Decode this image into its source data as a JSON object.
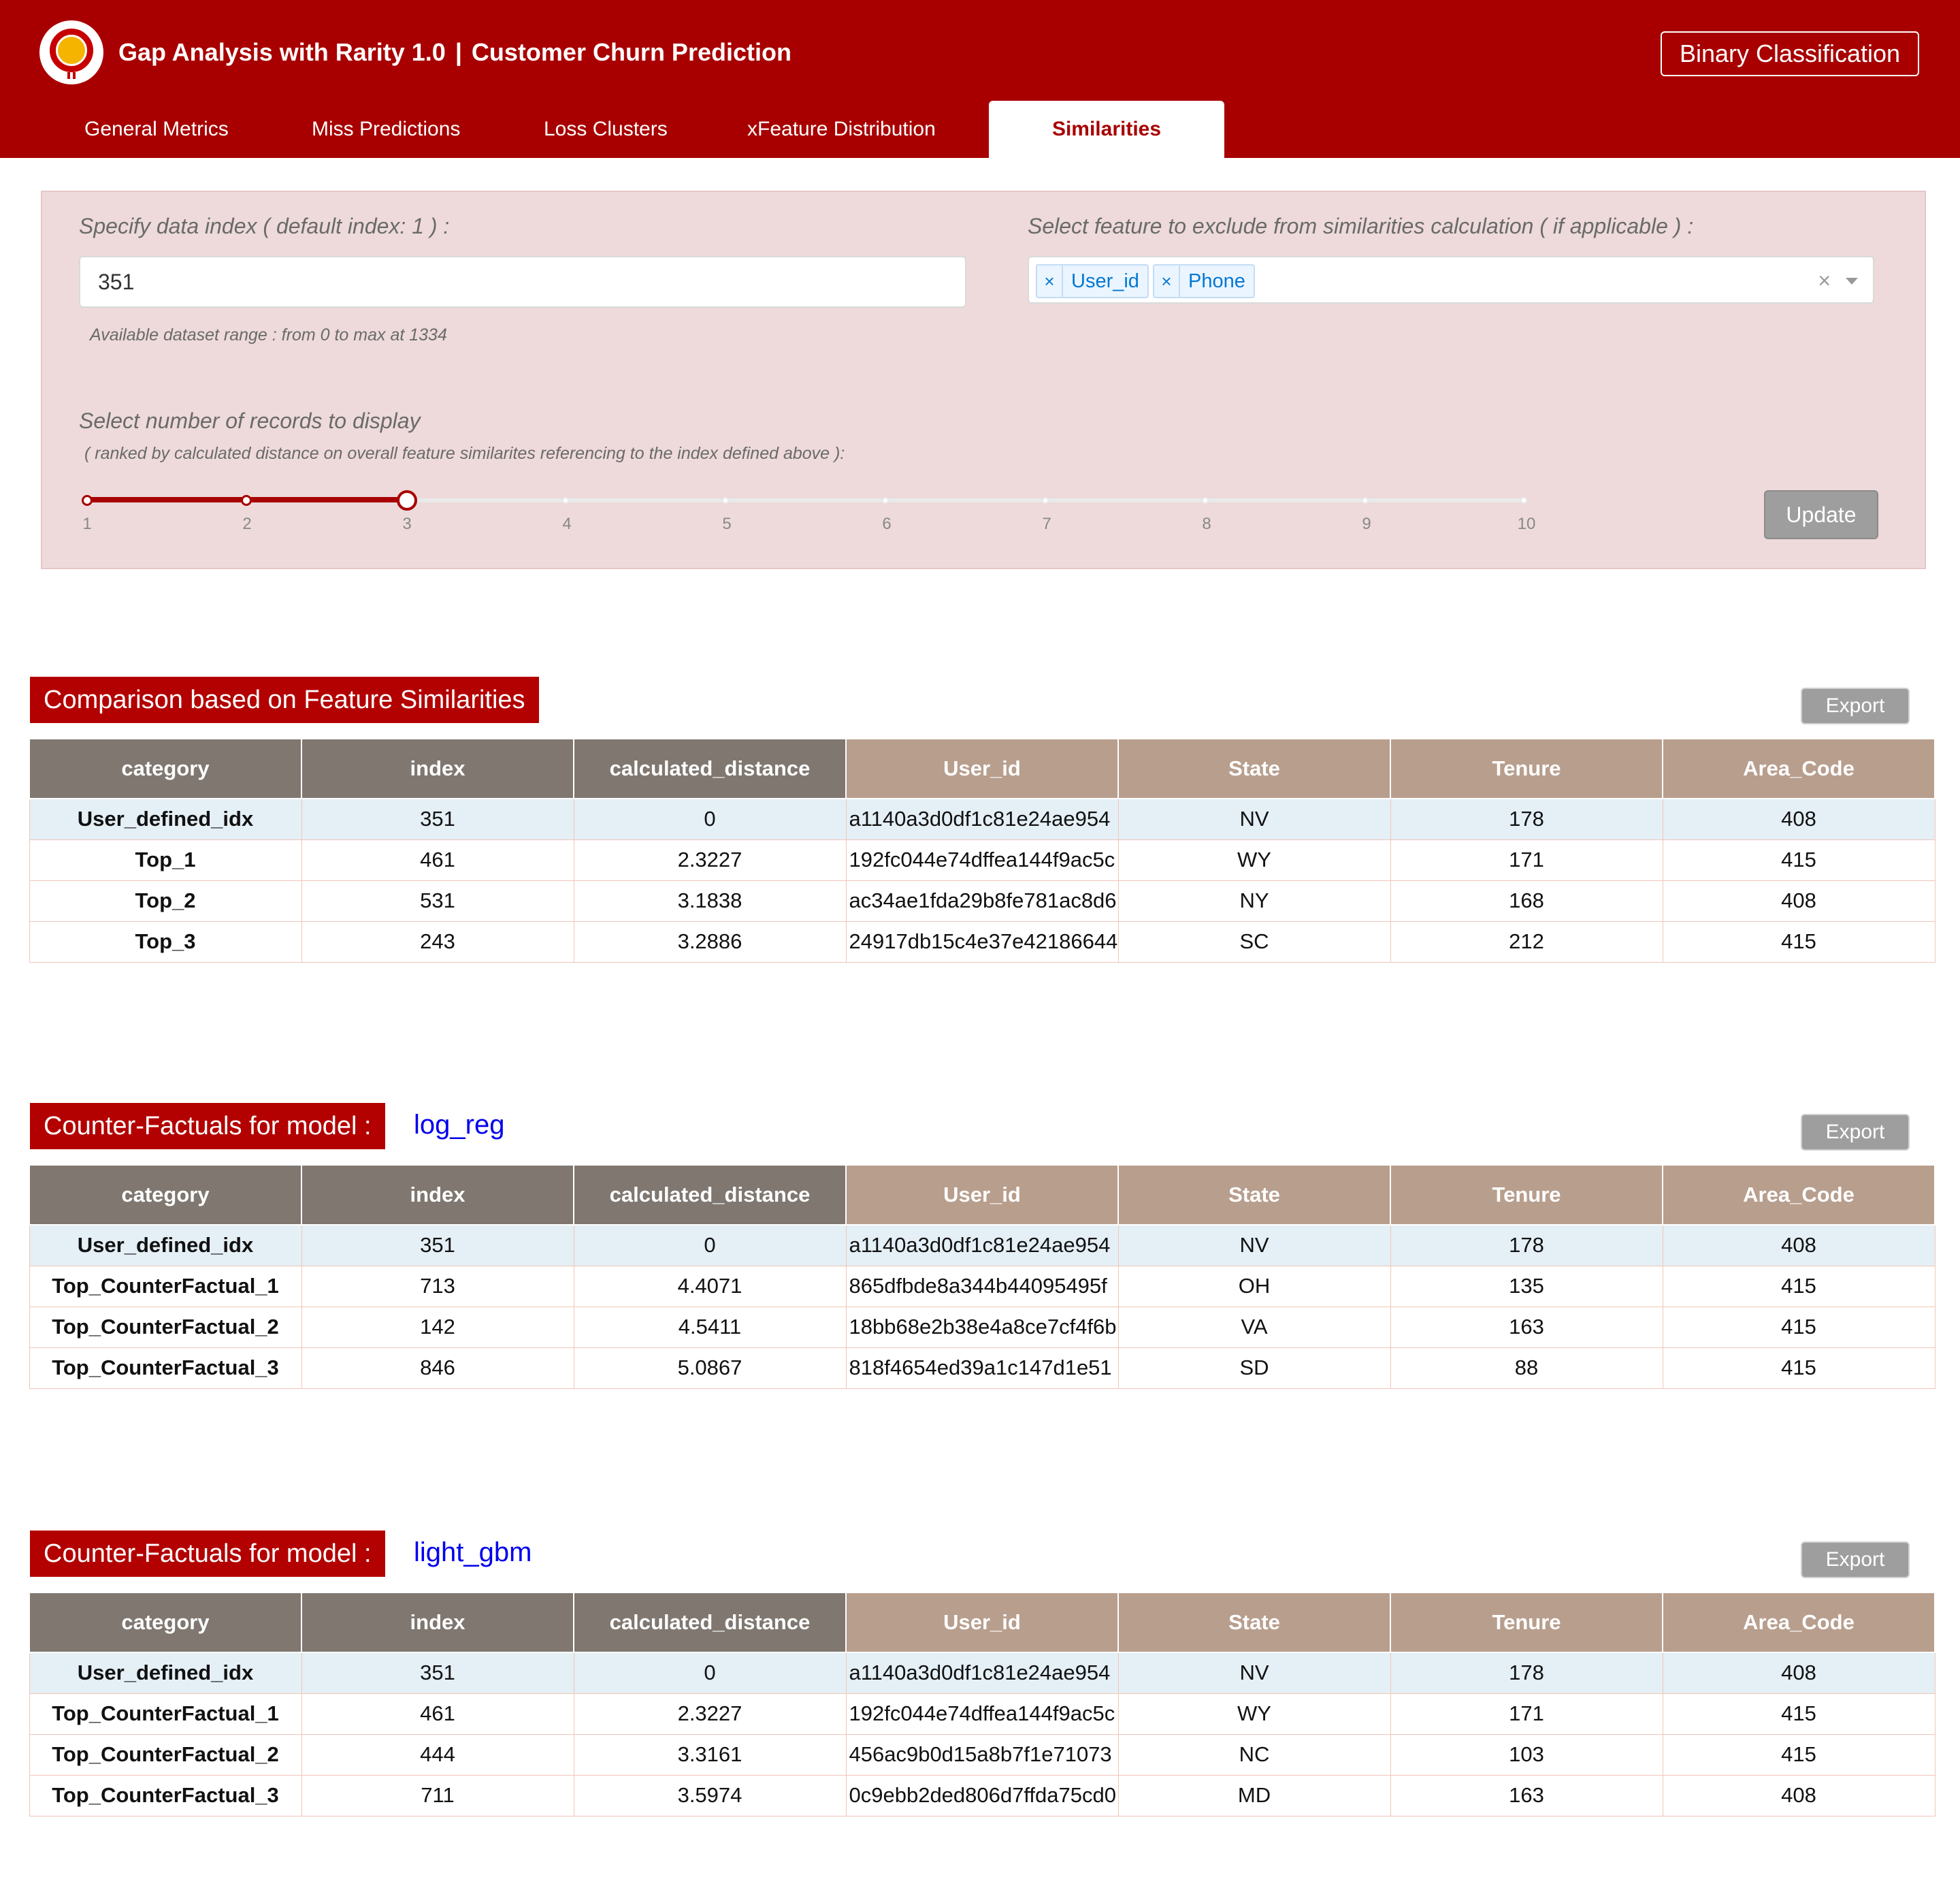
{
  "header": {
    "app_name": "Gap Analysis with Rarity 1.0",
    "separator": "|",
    "project": "Customer Churn Prediction",
    "mode_label": "Binary Classification"
  },
  "tabs": [
    {
      "label": "General Metrics",
      "active": false
    },
    {
      "label": "Miss Predictions",
      "active": false
    },
    {
      "label": "Loss Clusters",
      "active": false
    },
    {
      "label": "xFeature Distribution",
      "active": false
    },
    {
      "label": "Similarities",
      "active": true
    }
  ],
  "controls": {
    "index_label": "Specify data index ( default index: 1 ) :",
    "index_value": "351",
    "range_hint": "Available dataset range : from 0 to max at 1334",
    "exclude_label": "Select feature to exclude from similarities calculation ( if applicable ) :",
    "excluded_features": [
      "User_id",
      "Phone"
    ],
    "chip_remove_glyph": "×",
    "clear_glyph": "×",
    "records_label": "Select number of records to display",
    "records_sublabel": "( ranked by calculated distance on overall feature similarites referencing to the index defined above ):",
    "slider_marks": [
      "1",
      "2",
      "3",
      "4",
      "5",
      "6",
      "7",
      "8",
      "9",
      "10"
    ],
    "slider_value": 3,
    "update_label": "Update"
  },
  "columns": [
    "category",
    "index",
    "calculated_distance",
    "User_id",
    "State",
    "Tenure",
    "Area_Code"
  ],
  "export_label": "Export",
  "sections": [
    {
      "title": "Comparison based on Feature Similarities",
      "model": "",
      "rows": [
        [
          "User_defined_idx",
          "351",
          "0",
          "a1140a3d0df1c81e24ae954",
          "NV",
          "178",
          "408"
        ],
        [
          "Top_1",
          "461",
          "2.3227",
          "192fc044e74dffea144f9ac5c",
          "WY",
          "171",
          "415"
        ],
        [
          "Top_2",
          "531",
          "3.1838",
          "ac34ae1fda29b8fe781ac8d6",
          "NY",
          "168",
          "408"
        ],
        [
          "Top_3",
          "243",
          "3.2886",
          "24917db15c4e37e42186644",
          "SC",
          "212",
          "415"
        ]
      ]
    },
    {
      "title": "Counter-Factuals for model :",
      "model": "log_reg",
      "rows": [
        [
          "User_defined_idx",
          "351",
          "0",
          "a1140a3d0df1c81e24ae954",
          "NV",
          "178",
          "408"
        ],
        [
          "Top_CounterFactual_1",
          "713",
          "4.4071",
          "865dfbde8a344b44095495f",
          "OH",
          "135",
          "415"
        ],
        [
          "Top_CounterFactual_2",
          "142",
          "4.5411",
          "18bb68e2b38e4a8ce7cf4f6b",
          "VA",
          "163",
          "415"
        ],
        [
          "Top_CounterFactual_3",
          "846",
          "5.0867",
          "818f4654ed39a1c147d1e51",
          "SD",
          "88",
          "415"
        ]
      ]
    },
    {
      "title": "Counter-Factuals for model :",
      "model": "light_gbm",
      "rows": [
        [
          "User_defined_idx",
          "351",
          "0",
          "a1140a3d0df1c81e24ae954",
          "NV",
          "178",
          "408"
        ],
        [
          "Top_CounterFactual_1",
          "461",
          "2.3227",
          "192fc044e74dffea144f9ac5c",
          "WY",
          "171",
          "415"
        ],
        [
          "Top_CounterFactual_2",
          "444",
          "3.3161",
          "456ac9b0d15a8b7f1e71073",
          "NC",
          "103",
          "415"
        ],
        [
          "Top_CounterFactual_3",
          "711",
          "3.5974",
          "0c9ebb2ded806d7ffda75cd0",
          "MD",
          "163",
          "408"
        ]
      ]
    }
  ],
  "colors": {
    "brand": "#a80000",
    "header_gray": "#7f7770",
    "header_tan": "#b89e8d",
    "highlight_row": "#e4eff6",
    "model_link": "#0000ee"
  }
}
